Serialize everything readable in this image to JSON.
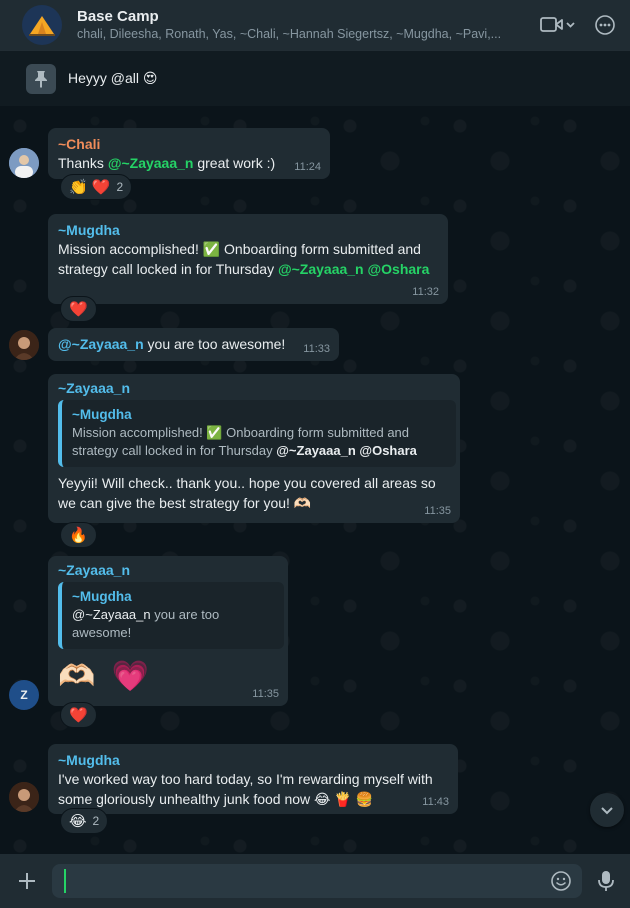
{
  "colors": {
    "accent_green": "#25d366",
    "accent_blue": "#53bdeb",
    "bubble": "#202c33",
    "background": "#0b141a",
    "sender_chali": "#f08c5a",
    "sender_mugdha": "#53bdeb",
    "sender_zayaaa": "#53bdeb"
  },
  "header": {
    "title": "Base Camp",
    "subtitle": "chali, Dileesha, Ronath, Yas, ~Chali, ~Hannah Siegertsz, ~Mugdha, ~Pavi,...",
    "video_icon": "video-camera-icon",
    "menu_icon": "more-options-icon"
  },
  "pinned": {
    "text": "Heyyy @all 😍",
    "icon": "pin-icon"
  },
  "messages": [
    {
      "sender": "~Chali",
      "pre": "Thanks ",
      "mention": "@~Zayaaa_n",
      "post": " great work :)",
      "time": "11:24",
      "reactions": "👏 ❤️",
      "reaction_count": "2"
    },
    {
      "sender": "~Mugdha",
      "line1": "Mission accomplished! ✅ Onboarding form submitted and",
      "line2_pre": "strategy call locked in for Thursday ",
      "mention1": "@~Zayaaa_n",
      "mention2": "@Oshara",
      "time": "11:32",
      "reactions": "❤️"
    },
    {
      "mention": "@~Zayaaa_n",
      "post": " you are too awesome!",
      "time": "11:33"
    },
    {
      "sender": "~Zayaaa_n",
      "quote_sender": "~Mugdha",
      "quote_line1": "Mission accomplished! ✅ Onboarding form submitted and",
      "quote_line2_pre": "strategy call locked in for Thursday ",
      "quote_mention1": "@~Zayaaa_n",
      "quote_mention2": "@Oshara",
      "line1": "Yeyyii! Will check..  thank you.. hope you covered all areas so",
      "line2": "we can give the best strategy for you! 🫶🏻",
      "time": "11:35",
      "reactions": "🔥"
    },
    {
      "sender": "~Zayaaa_n",
      "quote_sender": "~Mugdha",
      "quote_mention": "@~Zayaaa_n",
      "quote_post": " you are too awesome!",
      "emojis": "🫶🏻 💗",
      "time": "11:35",
      "reactions": "❤️",
      "avatar_letter": "Z"
    },
    {
      "sender": "~Mugdha",
      "line1": "I've worked way too hard today, so I'm rewarding myself with",
      "line2": "some gloriously unhealthy junk food now 😂 🍟 🍔",
      "time": "11:43",
      "reactions": "😂",
      "reaction_count": "2"
    }
  ],
  "footer": {
    "attach_icon": "plus-icon",
    "input_value": "",
    "input_placeholder": "",
    "emoji_icon": "emoji-icon",
    "mic_icon": "microphone-icon"
  }
}
